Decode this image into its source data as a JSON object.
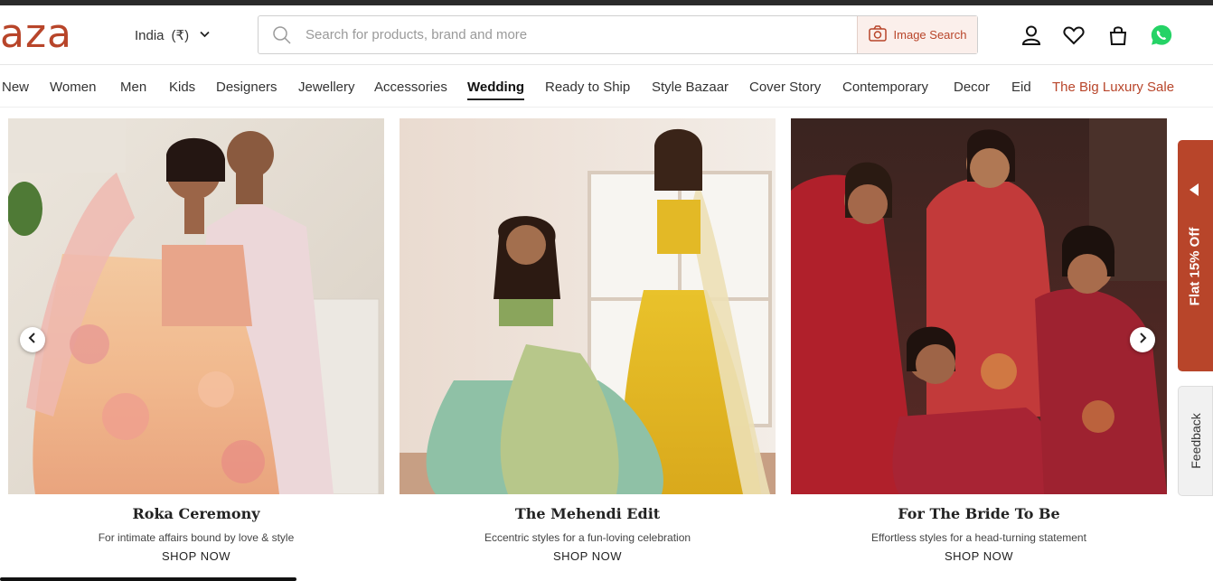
{
  "brand": {
    "logo_text": "aza",
    "color": "#b8452a"
  },
  "header": {
    "country": "India",
    "currency": "(₹)",
    "search": {
      "placeholder": "Search for products, brand and more",
      "value": ""
    },
    "image_search_label": "Image Search",
    "icons": [
      "user-icon",
      "heart-icon",
      "bag-icon",
      "whatsapp-icon"
    ]
  },
  "nav": {
    "items": [
      {
        "label": "New"
      },
      {
        "label": "Women"
      },
      {
        "label": "Men"
      },
      {
        "label": "Kids"
      },
      {
        "label": "Designers"
      },
      {
        "label": "Jewellery"
      },
      {
        "label": "Accessories"
      },
      {
        "label": "Wedding",
        "active": true
      },
      {
        "label": "Ready to Ship"
      },
      {
        "label": "Style Bazaar"
      },
      {
        "label": "Cover Story"
      },
      {
        "label": "Contemporary"
      },
      {
        "label": "Decor"
      },
      {
        "label": "Eid"
      },
      {
        "label": "The Big Luxury Sale",
        "highlight": true
      }
    ]
  },
  "cards": [
    {
      "title": "Roka Ceremony",
      "desc": "For intimate affairs bound by love & style",
      "cta": "SHOP NOW"
    },
    {
      "title": "The Mehendi Edit",
      "desc": "Eccentric styles for a fun-loving celebration",
      "cta": "SHOP NOW"
    },
    {
      "title": "For The Bride To Be",
      "desc": "Effortless styles for a head-turning statement",
      "cta": "SHOP NOW"
    }
  ],
  "side_tabs": {
    "offer": "Flat 15% Off",
    "feedback": "Feedback"
  }
}
